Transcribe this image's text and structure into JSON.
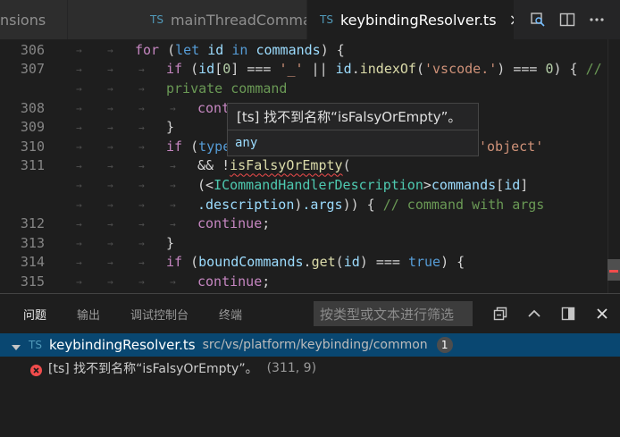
{
  "tabs": [
    {
      "label": "nsions",
      "lang": "",
      "active": false
    },
    {
      "label": "mainThreadCommands.ts",
      "lang": "TS",
      "active": false
    },
    {
      "label": "keybindingResolver.ts",
      "lang": "TS",
      "active": true,
      "close": "×"
    }
  ],
  "editor": {
    "lines": [
      {
        "n": "306"
      },
      {
        "n": "307"
      },
      {
        "n": ""
      },
      {
        "n": "308"
      },
      {
        "n": "309"
      },
      {
        "n": "310"
      },
      {
        "n": "311"
      },
      {
        "n": ""
      },
      {
        "n": ""
      },
      {
        "n": "312"
      },
      {
        "n": "313"
      },
      {
        "n": "314"
      },
      {
        "n": "315"
      }
    ],
    "tokens": {
      "for": "for",
      "let": "let",
      "id": "id",
      "in": "in",
      "commands": "commands",
      "if": "if",
      "zero": "0",
      "eq3": "===",
      "underscore": "'_'",
      "indexOf": "indexOf",
      "vscode": "'vscode.'",
      "comment307a": "//",
      "comment307b": "private command",
      "cont": "cont",
      "close_brace": "}",
      "type": "type",
      "object": "'object'",
      "amp": "&& !",
      "isFalsy": "isFalsyOrEmpty",
      "paren": "(",
      "lt": "(<",
      "ICmd": "ICommandHandlerDescription",
      "gt": ">",
      "description": ".description",
      "args": ".args",
      "comment311": "// command with args",
      "continue": "continue",
      "boundCommands": "boundCommands",
      "get": "get",
      "true": "true"
    }
  },
  "hover": {
    "message": "[ts] 找不到名称“isFalsyOrEmpty”。",
    "type": "any"
  },
  "panel": {
    "tabs": [
      "问题",
      "输出",
      "调试控制台",
      "终端"
    ],
    "filter_placeholder": "按类型或文本进行筛选",
    "file": {
      "lang": "TS",
      "name": "keybindingResolver.ts",
      "path": "src/vs/platform/keybinding/common",
      "count": "1"
    },
    "problem": {
      "message": "[ts] 找不到名称“isFalsyOrEmpty”。",
      "location": "(311, 9)"
    }
  },
  "colors": {
    "error": "#f14c4c",
    "selection": "#094771",
    "ts_icon": "#519aba"
  }
}
